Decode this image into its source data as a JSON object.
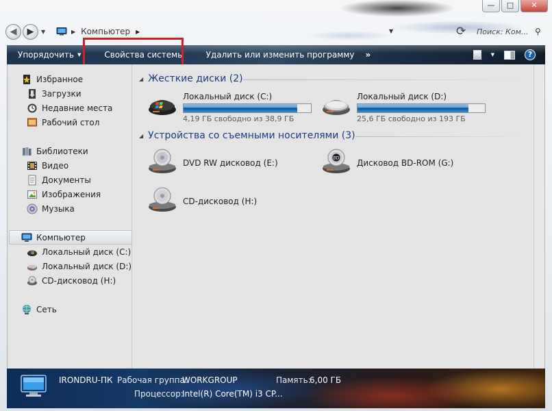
{
  "window": {
    "minimize": "—",
    "maximize": "□",
    "close": "✕"
  },
  "address": {
    "location": "Компьютер"
  },
  "search": {
    "placeholder": "Поиск: Ком..."
  },
  "toolbar": {
    "organize": "Упорядочить",
    "system_properties": "Свойства системы",
    "uninstall": "Удалить или изменить программу",
    "more": "»",
    "help": "?"
  },
  "colors": {
    "highlight_box": "#d81f26",
    "group_header": "#1e3a80",
    "bar_fill": "#1e6fb5"
  },
  "sidebar": {
    "favorites": {
      "title": "Избранное",
      "items": [
        "Загрузки",
        "Недавние места",
        "Рабочий стол"
      ]
    },
    "libraries": {
      "title": "Библиотеки",
      "items": [
        "Видео",
        "Документы",
        "Изображения",
        "Музыка"
      ]
    },
    "computer": {
      "title": "Компьютер",
      "items": [
        "Локальный диск (C:)",
        "Локальный диск (D:)",
        "CD-дисковод (H:)"
      ]
    },
    "network": {
      "title": "Сеть"
    }
  },
  "groups": {
    "hard_drives": {
      "title": "Жесткие диски (2)",
      "drives": [
        {
          "name": "Локальный диск (C:)",
          "free": "4,19 ГБ свободно из 38,9 ГБ",
          "used_fraction": 0.89,
          "icon": "hard-drive-windows-icon"
        },
        {
          "name": "Локальный диск (D:)",
          "free": "25,6 ГБ свободно из 193 ГБ",
          "used_fraction": 0.87,
          "icon": "hard-drive-icon"
        }
      ]
    },
    "removable": {
      "title": "Устройства со съемными носителями (3)",
      "devices": [
        {
          "name": "DVD RW дисковод (E:)",
          "icon": "dvd-drive-icon"
        },
        {
          "name": "Дисковод BD-ROM (G:)",
          "icon": "bd-rom-drive-icon"
        },
        {
          "name": "CD-дисковод (H:)",
          "icon": "cd-drive-icon"
        }
      ]
    }
  },
  "details": {
    "computer_name": "IRONDRU-ПК",
    "workgroup_label": "Рабочая группа:",
    "workgroup": "WORKGROUP",
    "memory_label": "Память:",
    "memory": "6,00 ГБ",
    "processor_label": "Процессор:",
    "processor": "Intel(R) Core(TM) i3 CP..."
  }
}
